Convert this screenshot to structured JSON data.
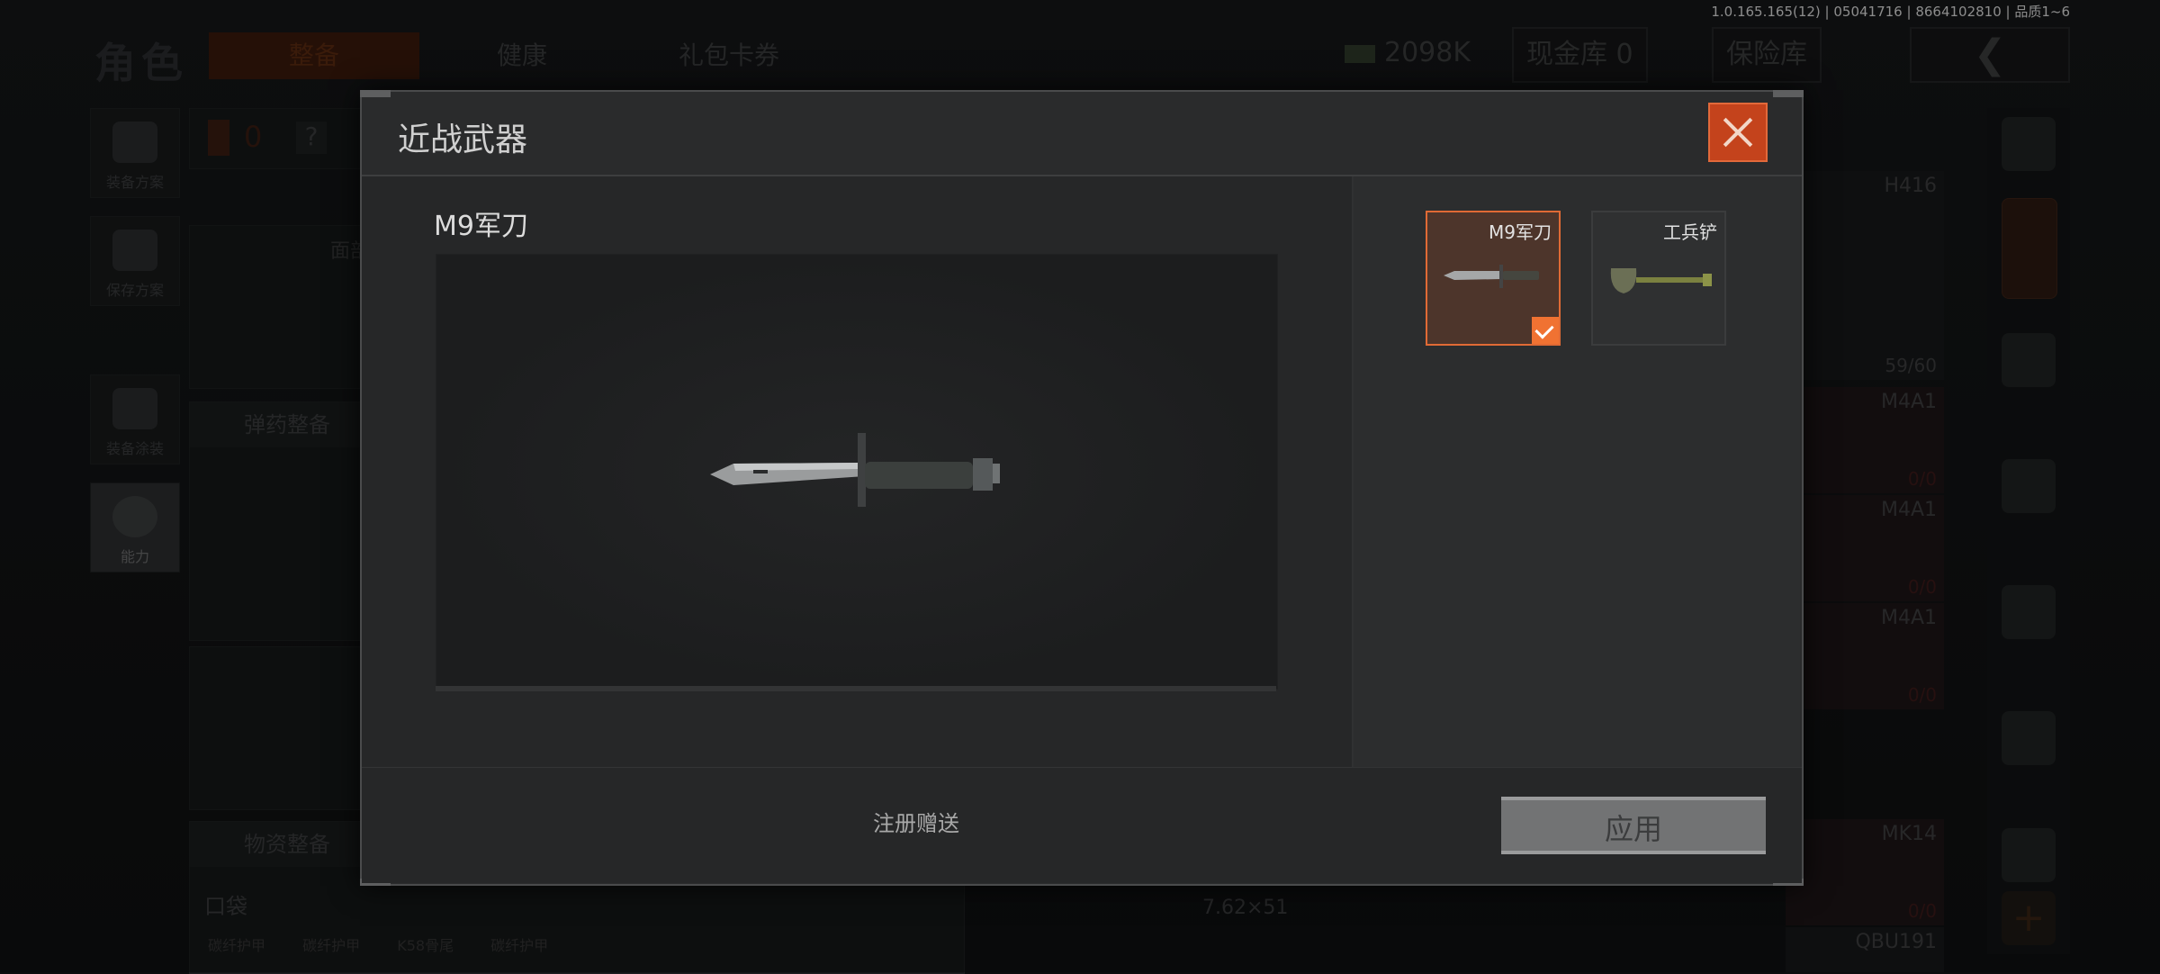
{
  "status": {
    "version": "1.0.165.165(12) | 05041716 | 8664102810 | 品质1~6"
  },
  "header": {
    "title": "角色",
    "tabs": [
      {
        "label": "整备",
        "active": true
      },
      {
        "label": "健康",
        "active": false
      },
      {
        "label": "礼包卡券",
        "active": false
      }
    ],
    "money": "2098K",
    "cash_vault": "现金库 0",
    "insurance_vault": "保险库",
    "back_icon": "chevron-left-icon"
  },
  "left_nav": [
    {
      "label": "装备方案",
      "icon": "vest-icon"
    },
    {
      "label": "保存方案",
      "icon": "download-icon"
    },
    {
      "label": "装备涂装",
      "icon": "helmet-icon"
    },
    {
      "label": "能力",
      "icon": "lightning-icon",
      "active": true
    }
  ],
  "loadout": {
    "armor_count": "0",
    "help": "?",
    "face_label": "面部",
    "ammo_section": "弹药整备",
    "supplies_section": "物资整备",
    "pocket_label": "口袋",
    "pocket_items": [
      "碳纤护甲",
      "碳纤护甲",
      "K58骨尾",
      "碳纤护甲"
    ],
    "caliber": "7.62×51"
  },
  "weapon_list": [
    {
      "name": "H416",
      "count": "59/60"
    },
    {
      "name": "M4A1",
      "count": "0/0"
    },
    {
      "name": "M4A1",
      "count": "0/0"
    },
    {
      "name": "M4A1",
      "count": "0/0"
    },
    {
      "name": "MK14",
      "count": "0/0"
    },
    {
      "name": "QBU191",
      "count": ""
    }
  ],
  "modal": {
    "title": "近战武器",
    "selected_name": "M9军刀",
    "items": [
      {
        "name": "M9军刀",
        "selected": true,
        "icon": "bayonet-icon"
      },
      {
        "name": "工兵铲",
        "selected": false,
        "icon": "shovel-icon"
      }
    ],
    "source_note": "注册赠送",
    "apply_label": "应用"
  },
  "colors": {
    "accent": "#e06a35",
    "close": "#c4431c",
    "modal_bg": "#2a2b2c"
  }
}
